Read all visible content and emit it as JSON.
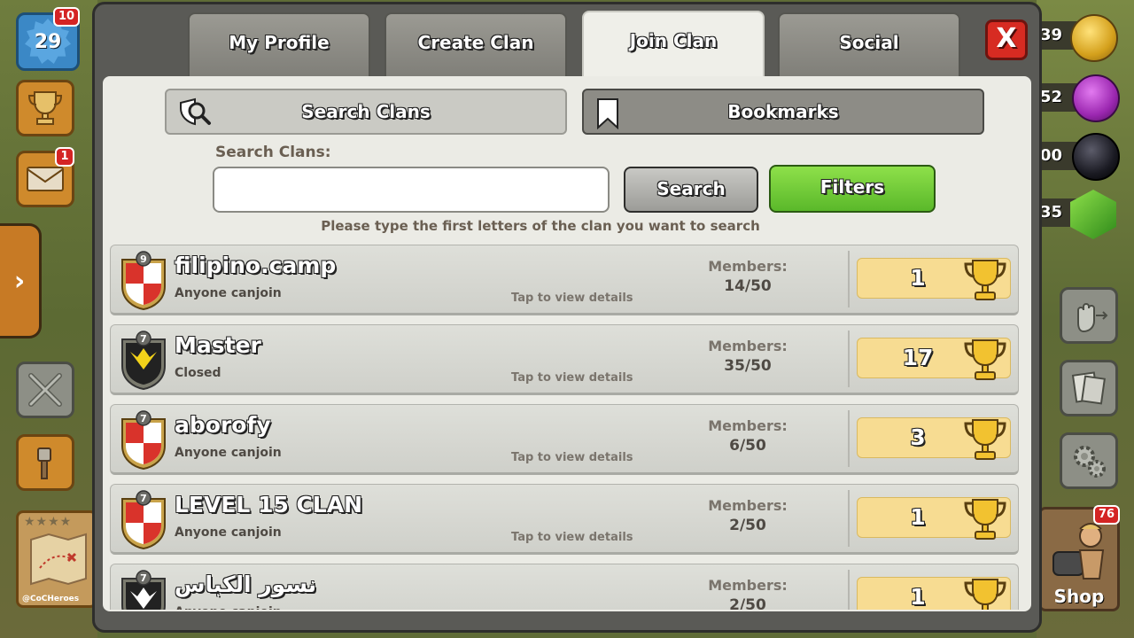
{
  "hud": {
    "level": "29",
    "level_notif": "10",
    "mail_notif": "1",
    "map_label": "@CoCHeroes",
    "res_gold": "39",
    "res_elixir": "52",
    "res_dark": "00",
    "res_gems": "35",
    "shop_notif": "76",
    "shop_label": "Shop"
  },
  "tabs": [
    {
      "label": "My Profile"
    },
    {
      "label": "Create Clan"
    },
    {
      "label": "Join Clan"
    },
    {
      "label": "Social"
    }
  ],
  "close_label": "X",
  "subtabs": {
    "search": "Search Clans",
    "bookmarks": "Bookmarks"
  },
  "search": {
    "label": "Search Clans:",
    "value": "",
    "placeholder": "",
    "button": "Search",
    "filters": "Filters",
    "hint": "Please type the first letters of the clan you want to search"
  },
  "clans": [
    {
      "name": "filipino.camp",
      "type": "Anyone canjoin",
      "level": "9",
      "members_label": "Members:",
      "members": "14/50",
      "trophies": "1",
      "tap": "Tap to view details"
    },
    {
      "name": "Master",
      "type": "Closed",
      "level": "7",
      "members_label": "Members:",
      "members": "35/50",
      "trophies": "17",
      "tap": "Tap to view details"
    },
    {
      "name": "aborofy",
      "type": "Anyone canjoin",
      "level": "7",
      "members_label": "Members:",
      "members": "6/50",
      "trophies": "3",
      "tap": "Tap to view details"
    },
    {
      "name": "LEVEL 15 CLAN",
      "type": "Anyone canjoin",
      "level": "7",
      "members_label": "Members:",
      "members": "2/50",
      "trophies": "1",
      "tap": "Tap to view details"
    },
    {
      "name": "نسور الكباس",
      "type": "Anyone canjoin",
      "level": "7",
      "members_label": "Members:",
      "members": "2/50",
      "trophies": "1",
      "tap": ""
    }
  ],
  "colors": {
    "accent_green": "#5ab82a",
    "close_red": "#d72b22",
    "trophy_bg": "#f7dc92",
    "badge_red": "#d9332b"
  }
}
